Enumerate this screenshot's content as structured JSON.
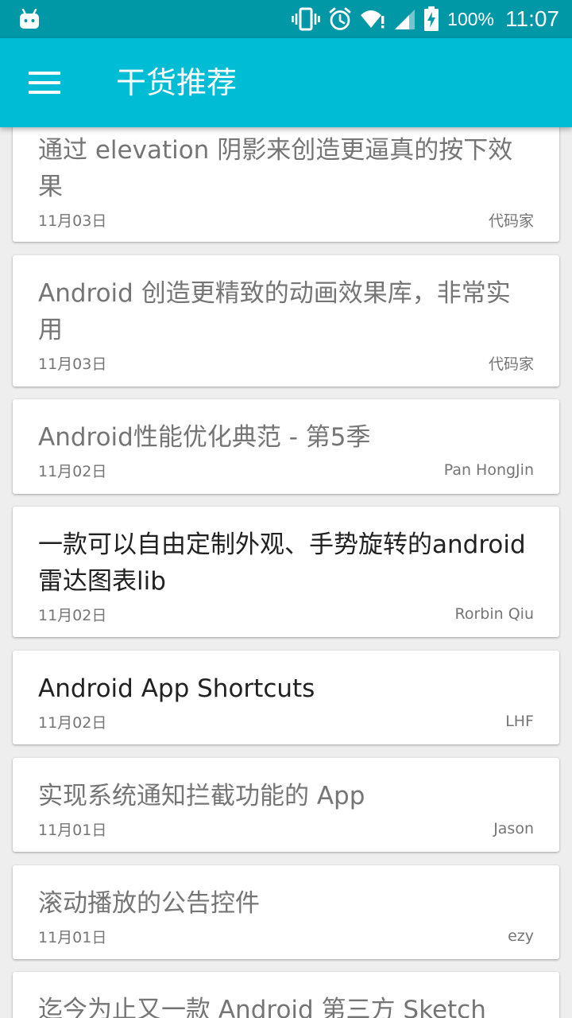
{
  "status_bar": {
    "battery_percent": "100%",
    "time": "11:07"
  },
  "toolbar": {
    "title": "干货推荐"
  },
  "articles": [
    {
      "title": "通过 elevation 阴影来创造更逼真的按下效果",
      "date": "11月03日",
      "author": "代码家",
      "read": true
    },
    {
      "title": "Android 创造更精致的动画效果库，非常实用",
      "date": "11月03日",
      "author": "代码家",
      "read": true
    },
    {
      "title": "Android性能优化典范 - 第5季",
      "date": "11月02日",
      "author": "Pan HongJin",
      "read": true
    },
    {
      "title": "一款可以自由定制外观、手势旋转的android雷达图表lib",
      "date": "11月02日",
      "author": "Rorbin Qiu",
      "read": false
    },
    {
      "title": "Android App Shortcuts",
      "date": "11月02日",
      "author": "LHF",
      "read": false
    },
    {
      "title": "实现系统通知拦截功能的 App",
      "date": "11月01日",
      "author": "Jason",
      "read": true
    },
    {
      "title": "滚动播放的公告控件",
      "date": "11月01日",
      "author": "ezy",
      "read": true
    },
    {
      "title": "迄今为止又一款 Android 第三方 Sketch",
      "date": "",
      "author": "",
      "read": true
    }
  ]
}
